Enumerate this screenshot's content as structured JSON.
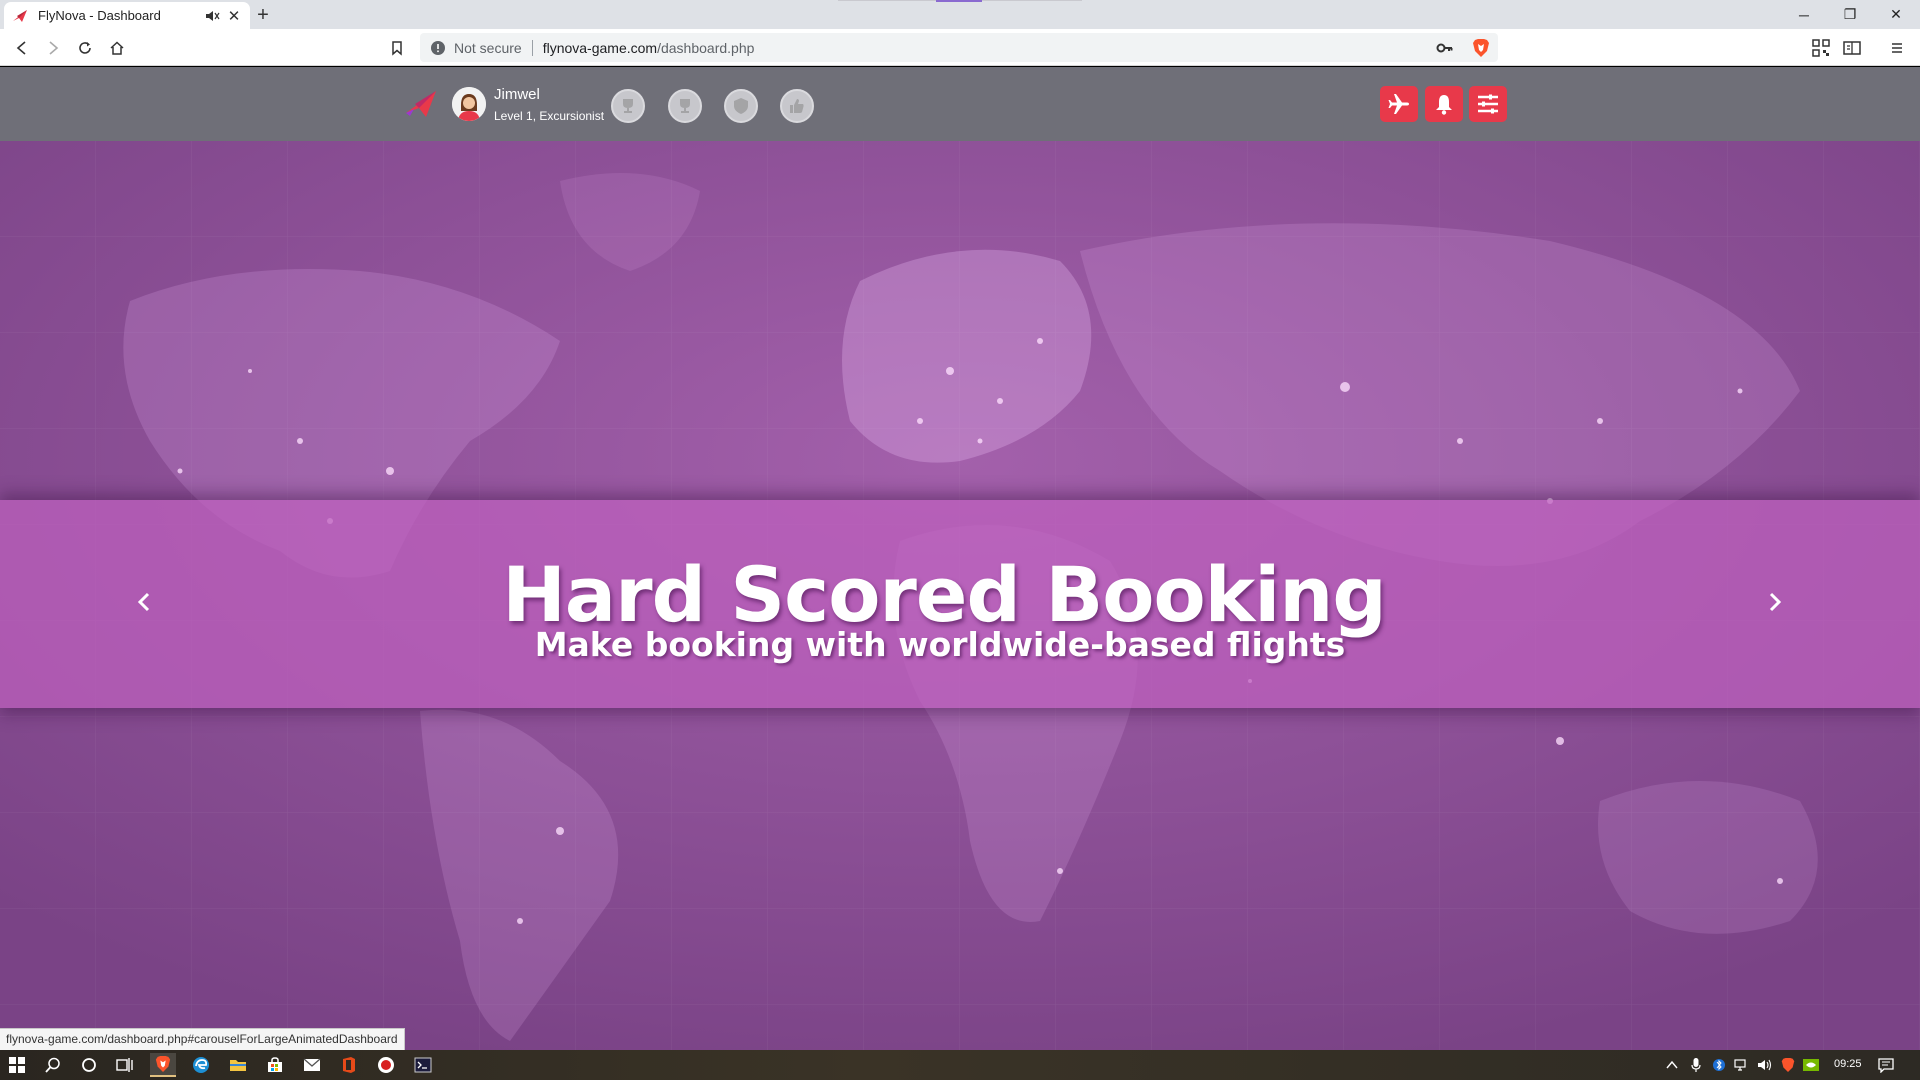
{
  "browser": {
    "tab_title": "FlyNova - Dashboard",
    "new_tab_symbol": "+",
    "address": {
      "security_label": "Not secure",
      "url_host": "flynova-game.com",
      "url_path": "/dashboard.php"
    },
    "status_link": "flynova-game.com/dashboard.php#carouselForLargeAnimatedDashboard",
    "icons": [
      "back-icon",
      "forward-icon",
      "reload-icon",
      "home-icon",
      "bookmark-icon",
      "info-icon",
      "key-icon",
      "brave-shield-icon",
      "qr-icon",
      "reading-list-icon",
      "menu-icon"
    ]
  },
  "header": {
    "user_name": "Jimwel",
    "user_level": "Level 1, Excursionist",
    "badges": [
      "badge-1",
      "badge-2",
      "badge-3",
      "badge-4"
    ],
    "actions": [
      "flights-button",
      "notifications-button",
      "settings-button"
    ],
    "accent_color": "#e8394a"
  },
  "carousel": {
    "title": "Hard Scored Booking",
    "subtitle": "Make booking with worldwide-based flights",
    "background_color": "#8a4d94"
  },
  "taskbar": {
    "clock": "09:25"
  }
}
